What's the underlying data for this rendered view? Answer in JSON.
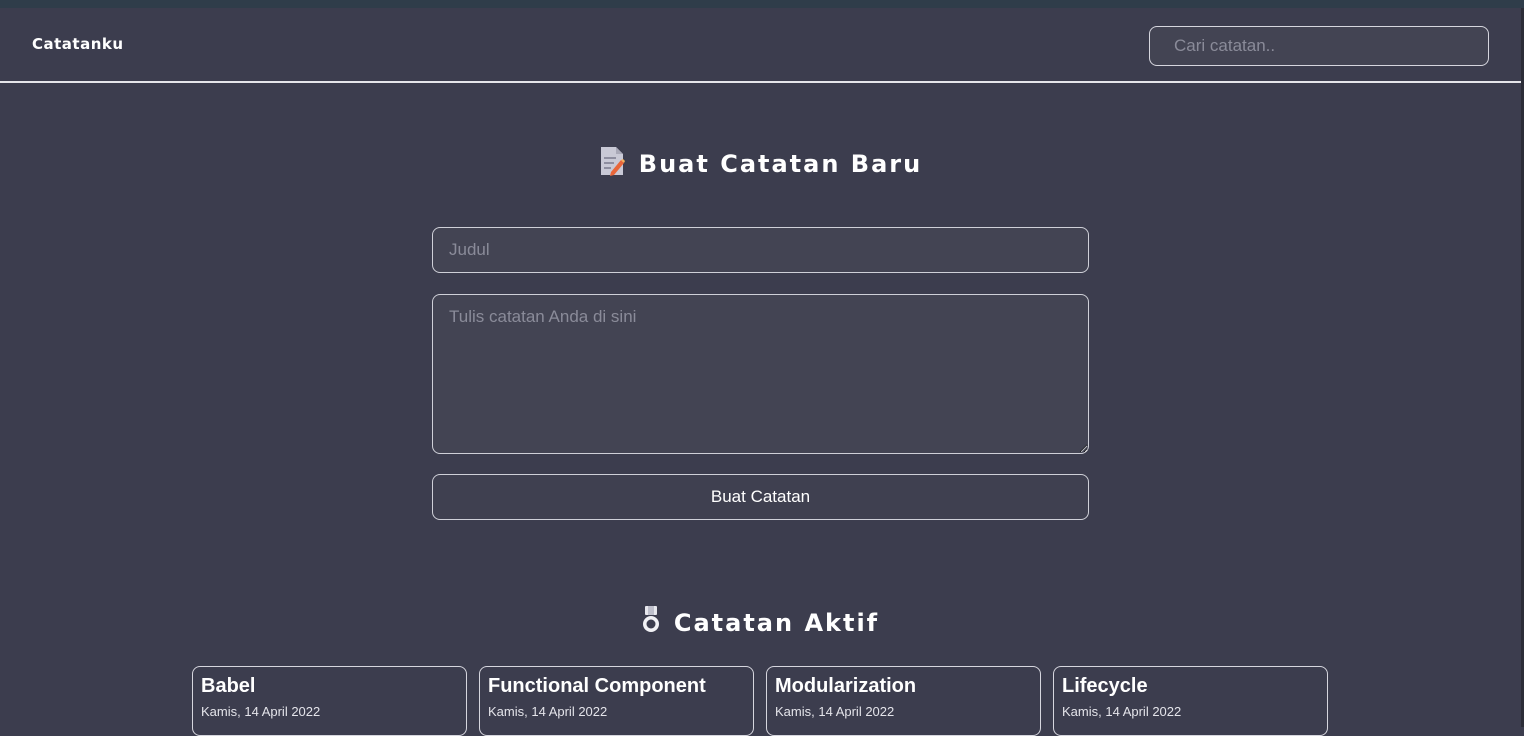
{
  "header": {
    "brand": "Catatanku",
    "search_placeholder": "Cari catatan.."
  },
  "create_section": {
    "title": "Buat Catatan Baru",
    "icon": "memo-icon",
    "title_placeholder": "Judul",
    "body_placeholder": "Tulis catatan Anda di sini",
    "submit_label": "Buat Catatan"
  },
  "active_section": {
    "title": "Catatan Aktif",
    "icon": "medal-icon"
  },
  "notes": [
    {
      "title": "Babel",
      "date": "Kamis, 14 April 2022"
    },
    {
      "title": "Functional Component",
      "date": "Kamis, 14 April 2022"
    },
    {
      "title": "Modularization",
      "date": "Kamis, 14 April 2022"
    },
    {
      "title": "Lifecycle",
      "date": "Kamis, 14 April 2022"
    }
  ],
  "colors": {
    "background": "#3c3d4e",
    "input_background": "#434453",
    "border": "#cfd0d8"
  }
}
